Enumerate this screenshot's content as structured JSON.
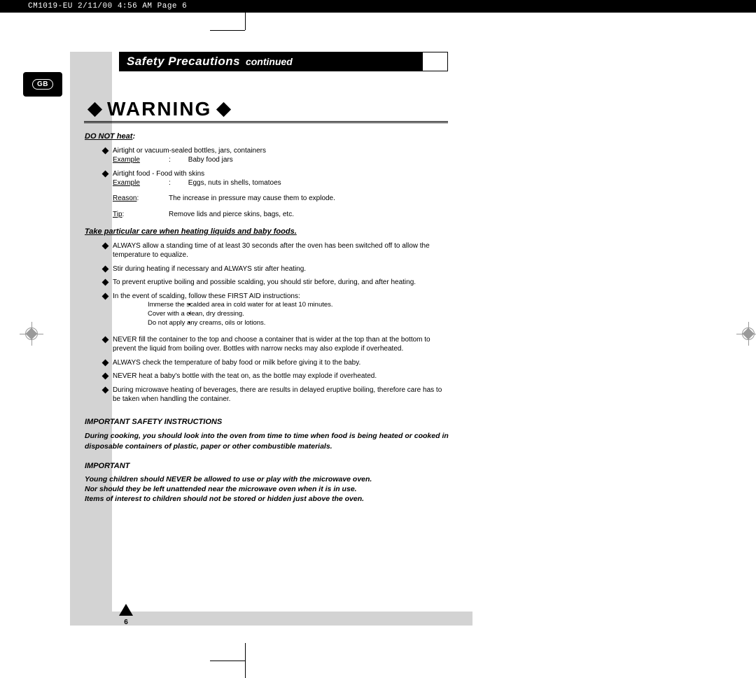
{
  "print_header": "CM1019-EU  2/11/00 4:56 AM  Page 6",
  "badge": "GB",
  "title": {
    "main": "Safety Precautions",
    "sub": "continued"
  },
  "warning": "WARNING",
  "do_not_heat": {
    "heading": "DO NOT heat",
    "items": [
      {
        "text": "Airtight or vacuum-sealed bottles, jars, containers",
        "example_lbl": "Example",
        "example": "Baby food jars"
      },
      {
        "text": "Airtight food - Food with skins",
        "example_lbl": "Example",
        "example": "Eggs, nuts in shells, tomatoes"
      }
    ],
    "reason_lbl": "Reason",
    "reason": "The increase in pressure may cause them to explode.",
    "tip_lbl": "Tip",
    "tip": "Remove lids and pierce skins, bags, etc."
  },
  "liquids": {
    "heading": "Take particular care when heating liquids and baby foods.",
    "bullets1": [
      "ALWAYS allow a standing time of at least 30 seconds after the oven has been switched off to allow the temperature to equalize.",
      "Stir during heating if necessary and ALWAYS stir after heating.",
      "To prevent eruptive boiling and possible scalding, you should stir before, during, and after heating.",
      "In the event of scalding, follow these FIRST AID instructions:"
    ],
    "first_aid": [
      "Immerse the scalded area in cold water for at least 10 minutes.",
      "Cover with a clean, dry dressing.",
      "Do not apply any creams, oils or lotions."
    ],
    "bullets2": [
      "NEVER fill the container to the top and choose a container that is wider at the top than at the bottom to prevent the liquid from boiling over. Bottles with narrow necks may also explode if overheated.",
      "ALWAYS check the temperature of baby food or milk before giving it to the baby.",
      "NEVER heat a baby's bottle with the teat on, as the bottle may explode if overheated.",
      "During microwave heating of beverages, there are results in delayed eruptive boiling, therefore care has to be taken when handling the container."
    ]
  },
  "safety": {
    "heading": "IMPORTANT SAFETY INSTRUCTIONS",
    "para": "During cooking, you should look into the oven from time to time when food is being heated or cooked in disposable containers of plastic, paper or other combustible materials.",
    "heading2": "IMPORTANT",
    "lines": [
      "Young children should NEVER be allowed to use or play with the microwave oven.",
      "Nor should they be left unattended near the microwave oven when it is in use.",
      "Items of interest to children should not be stored or hidden just above the oven."
    ]
  },
  "page_number": "6"
}
